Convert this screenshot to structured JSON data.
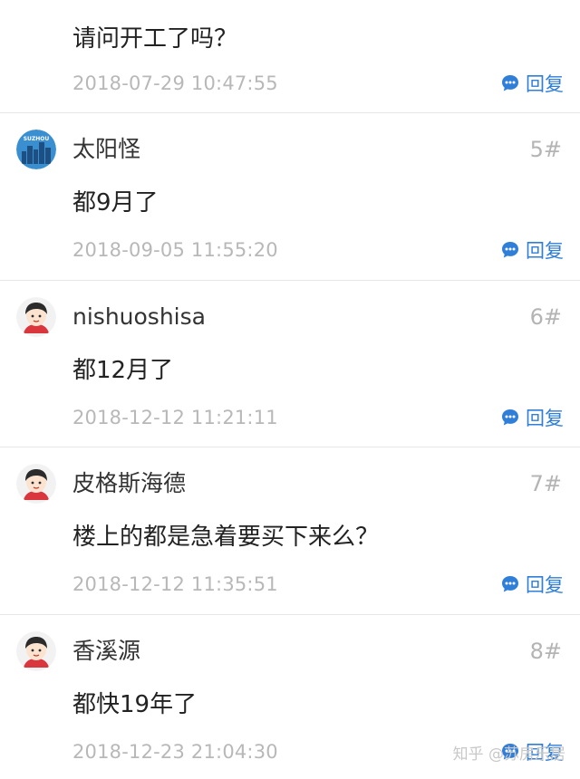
{
  "first_comment": {
    "content": "请问开工了吗？",
    "time": "2018-07-29 10:47:55",
    "reply_label": "回复"
  },
  "comments": [
    {
      "author": "太阳怪",
      "floor": "5#",
      "content": "都9月了",
      "time": "2018-09-05 11:55:20",
      "reply_label": "回复",
      "avatar": "suzhou-skyline-avatar",
      "avatar_text": "SUZHOU"
    },
    {
      "author": "nishuoshisa",
      "floor": "6#",
      "content": "都12月了",
      "time": "2018-12-12 11:21:11",
      "reply_label": "回复",
      "avatar": "default-boy-avatar"
    },
    {
      "author": "皮格斯海德",
      "floor": "7#",
      "content": "楼上的都是急着要买下来么？",
      "time": "2018-12-12 11:35:51",
      "reply_label": "回复",
      "avatar": "default-boy-avatar"
    },
    {
      "author": "香溪源",
      "floor": "8#",
      "content": "都快19年了",
      "time": "2018-12-23 21:04:30",
      "reply_label": "回复",
      "avatar": "default-boy-avatar"
    }
  ],
  "watermark": "知乎 @苏房乐居",
  "colors": {
    "accent": "#2f7ed8",
    "time": "#b8b8b8",
    "floor": "#b4b4b4",
    "text": "#222222",
    "divider": "#e6e6e6"
  }
}
